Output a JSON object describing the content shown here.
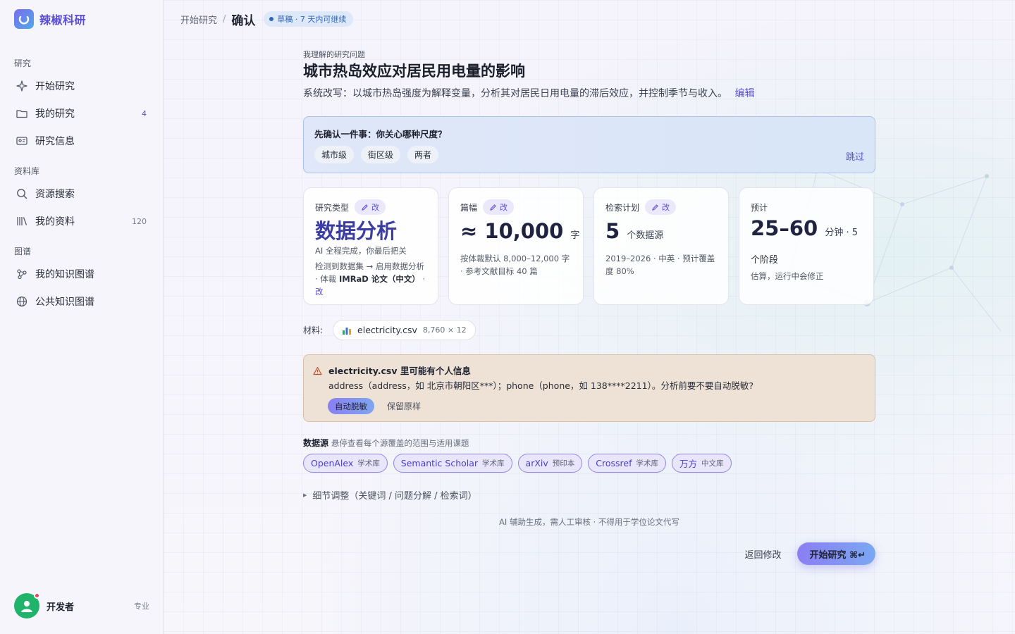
{
  "brand": {
    "name": "辣椒科研"
  },
  "sidebar": {
    "sections": [
      {
        "title": "研究"
      },
      {
        "title": "资料库"
      },
      {
        "title": "图谱"
      }
    ],
    "items": [
      {
        "label": "开始研究",
        "badge": ""
      },
      {
        "label": "我的研究",
        "badge": "4"
      },
      {
        "label": "研究信息",
        "badge": ""
      },
      {
        "label": "资源搜索",
        "badge": ""
      },
      {
        "label": "我的资料",
        "badge": "120"
      },
      {
        "label": "我的知识图谱",
        "badge": ""
      },
      {
        "label": "公共知识图谱",
        "badge": ""
      }
    ],
    "user": {
      "name": "开发者",
      "plan": "专业"
    }
  },
  "breadcrumb": {
    "parent": "开始研究",
    "sep": "/",
    "current": "确认",
    "badge": "草稿 · 7 天内可继续"
  },
  "question": {
    "label": "我理解的研究问题",
    "title": "城市热岛效应对居民用电量的影响",
    "rewrite": "系统改写：以城市热岛强度为解释变量，分析其对居民日用电量的滞后效应，并控制季节与收入。",
    "edit_label": "编辑"
  },
  "scale_confirm": {
    "title": "先确认一件事：你关心哪种尺度？",
    "options": [
      "城市级",
      "街区级",
      "两者"
    ],
    "skip_label": "跳过"
  },
  "cards": {
    "edit_label": "改",
    "type": {
      "label": "研究类型",
      "value": "数据分析",
      "sub": "AI 全程完成，你最后把关",
      "detail_prefix": "检测到数据集 → 启用数据分析 · 体裁 ",
      "detail_strong": "IMRaD 论文（中文）",
      "detail_link": " · 改"
    },
    "length": {
      "label": "篇幅",
      "value": "≈ 10,000",
      "unit": "字",
      "sub": "按体裁默认 8,000–12,000 字 · 参考文献目标 40 篇"
    },
    "search": {
      "label": "检索计划",
      "value": "5",
      "unit": "个数据源",
      "sub": "2019–2026 · 中英 · 预计覆盖度 80%"
    },
    "estimate": {
      "label": "预计",
      "value": "25–60",
      "unit": "分钟 · 5",
      "unit2": "个阶段",
      "sub": "估算，运行中会修正"
    }
  },
  "materials": {
    "label": "材料:",
    "file_name": "electricity.csv",
    "file_meta": "8,760 × 12"
  },
  "privacy_warning": {
    "title": "electricity.csv 里可能有个人信息",
    "text": "address（address，如 北京市朝阳区***）；phone（phone，如 138****2211）。分析前要不要自动脱敏?",
    "primary_label": "自动脱敏",
    "secondary_label": "保留原样"
  },
  "datasources": {
    "title": "数据源",
    "hint": "悬停查看每个源覆盖的范围与适用课题",
    "items": [
      {
        "name": "OpenAlex",
        "tag": "学术库"
      },
      {
        "name": "Semantic Scholar",
        "tag": "学术库"
      },
      {
        "name": "arXiv",
        "tag": "预印本"
      },
      {
        "name": "Crossref",
        "tag": "学术库"
      },
      {
        "name": "万方",
        "tag": "中文库"
      }
    ]
  },
  "fine_tune": {
    "label": "细节调整（关键词 / 问题分解 / 检索词）"
  },
  "disclaimer": "AI 辅助生成，需人工审核 · 不得用于学位论文代写",
  "actions": {
    "back_label": "返回修改",
    "start_label": "开始研究 ⌘↵"
  },
  "colors": {
    "accent": "#5a4fd6",
    "warning_bg": "#eee2d6",
    "info_bg": "#dfe7f8"
  }
}
